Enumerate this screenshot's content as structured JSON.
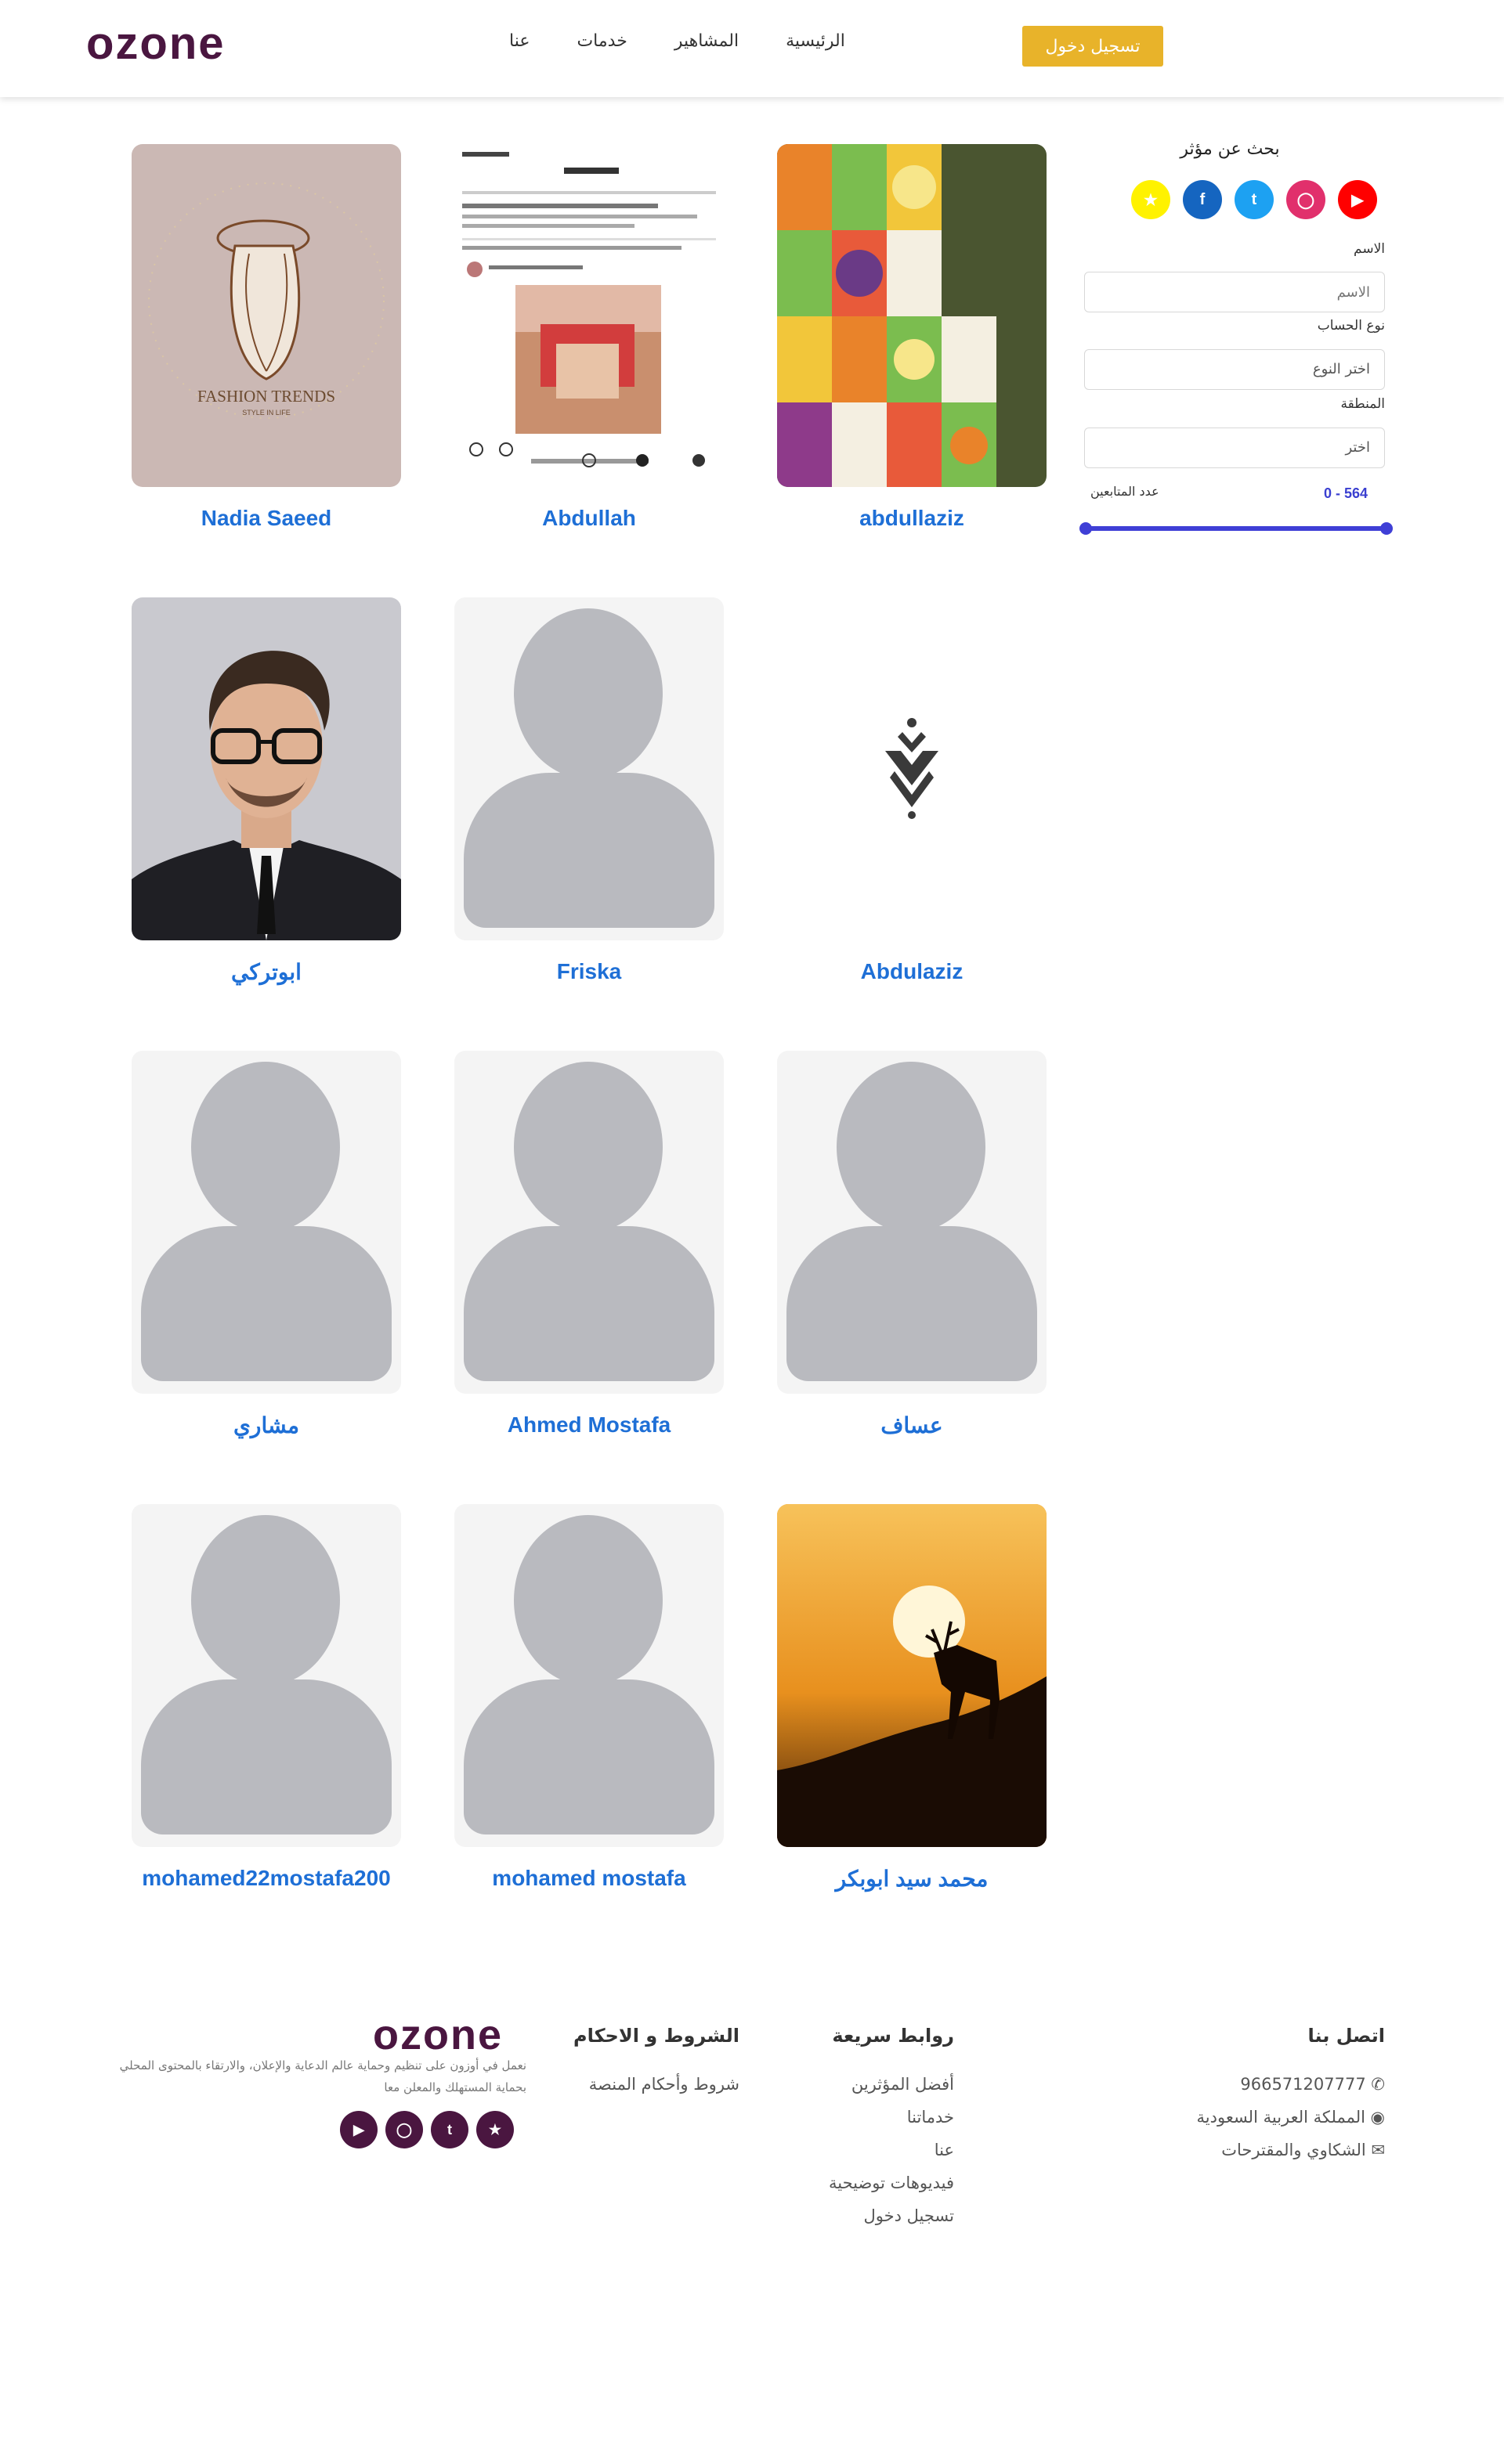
{
  "header": {
    "logo": "ozone",
    "nav": [
      "الرئيسية",
      "المشاهير",
      "خدمات",
      "عنا"
    ],
    "login": "تسجيل دخول"
  },
  "influencers": [
    {
      "name": "Nadia Saeed",
      "image": "fashion-trends"
    },
    {
      "name": "Abdullah",
      "image": "instagram-screenshot"
    },
    {
      "name": "abdullaziz",
      "image": "vegetables-art"
    },
    {
      "name": "ابوتركي",
      "image": "man-glasses-photo"
    },
    {
      "name": "Friska",
      "image": "placeholder-avatar"
    },
    {
      "name": "Abdulaziz",
      "image": "logo-mark"
    },
    {
      "name": "مشاري",
      "image": "placeholder-avatar"
    },
    {
      "name": "Ahmed Mostafa",
      "image": "placeholder-avatar"
    },
    {
      "name": "عساف",
      "image": "placeholder-avatar"
    },
    {
      "name": "mohamed22mostafa200",
      "image": "placeholder-avatar"
    },
    {
      "name": "mohamed mostafa",
      "image": "placeholder-avatar"
    },
    {
      "name": "محمد سيد ابوبكر",
      "image": "deer-sunset"
    }
  ],
  "fashion_card": {
    "title": "FASHION TRENDS",
    "subtitle": "STYLE IN LIFE"
  },
  "search": {
    "title": "بحث عن مؤثر",
    "socials": [
      "snapchat-icon",
      "facebook-icon",
      "twitter-icon",
      "instagram-icon",
      "youtube-icon"
    ],
    "name_label": "الاسم",
    "name_placeholder": "الاسم",
    "type_label": "نوع الحساب",
    "type_value": "اختر النوع",
    "region_label": "المنطقة",
    "region_value": "اختر",
    "followers_label": "عدد المتابعين",
    "followers_range": "0 - 564",
    "range": [
      0,
      564
    ]
  },
  "footer": {
    "contact_title": "اتصل بنا",
    "phone": "966571207777",
    "country": "المملكة العربية السعودية",
    "complaints": "الشكاوي والمقترحات",
    "quick_title": "روابط سريعة",
    "quick_links": [
      "أفضل المؤثرين",
      "خدماتنا",
      "عنا",
      "فيديوهات توضيحية",
      "تسجيل دخول"
    ],
    "terms_title": "الشروط و الاحكام",
    "terms_link": "شروط وأحكام المنصة",
    "logo": "ozone",
    "about": "نعمل في أوزون على تنظيم وحماية عالم الدعاية والإعلان، والارتقاء بالمحتوى المحلي بحماية المستهلك والمعلن معا",
    "socials": [
      "youtube-icon",
      "instagram-icon",
      "twitter-icon",
      "snapchat-icon"
    ]
  },
  "colors": {
    "accent": "#e8b32a",
    "brand": "#4a1640",
    "link": "#1e6fd6",
    "slider": "#3f3fd6"
  }
}
